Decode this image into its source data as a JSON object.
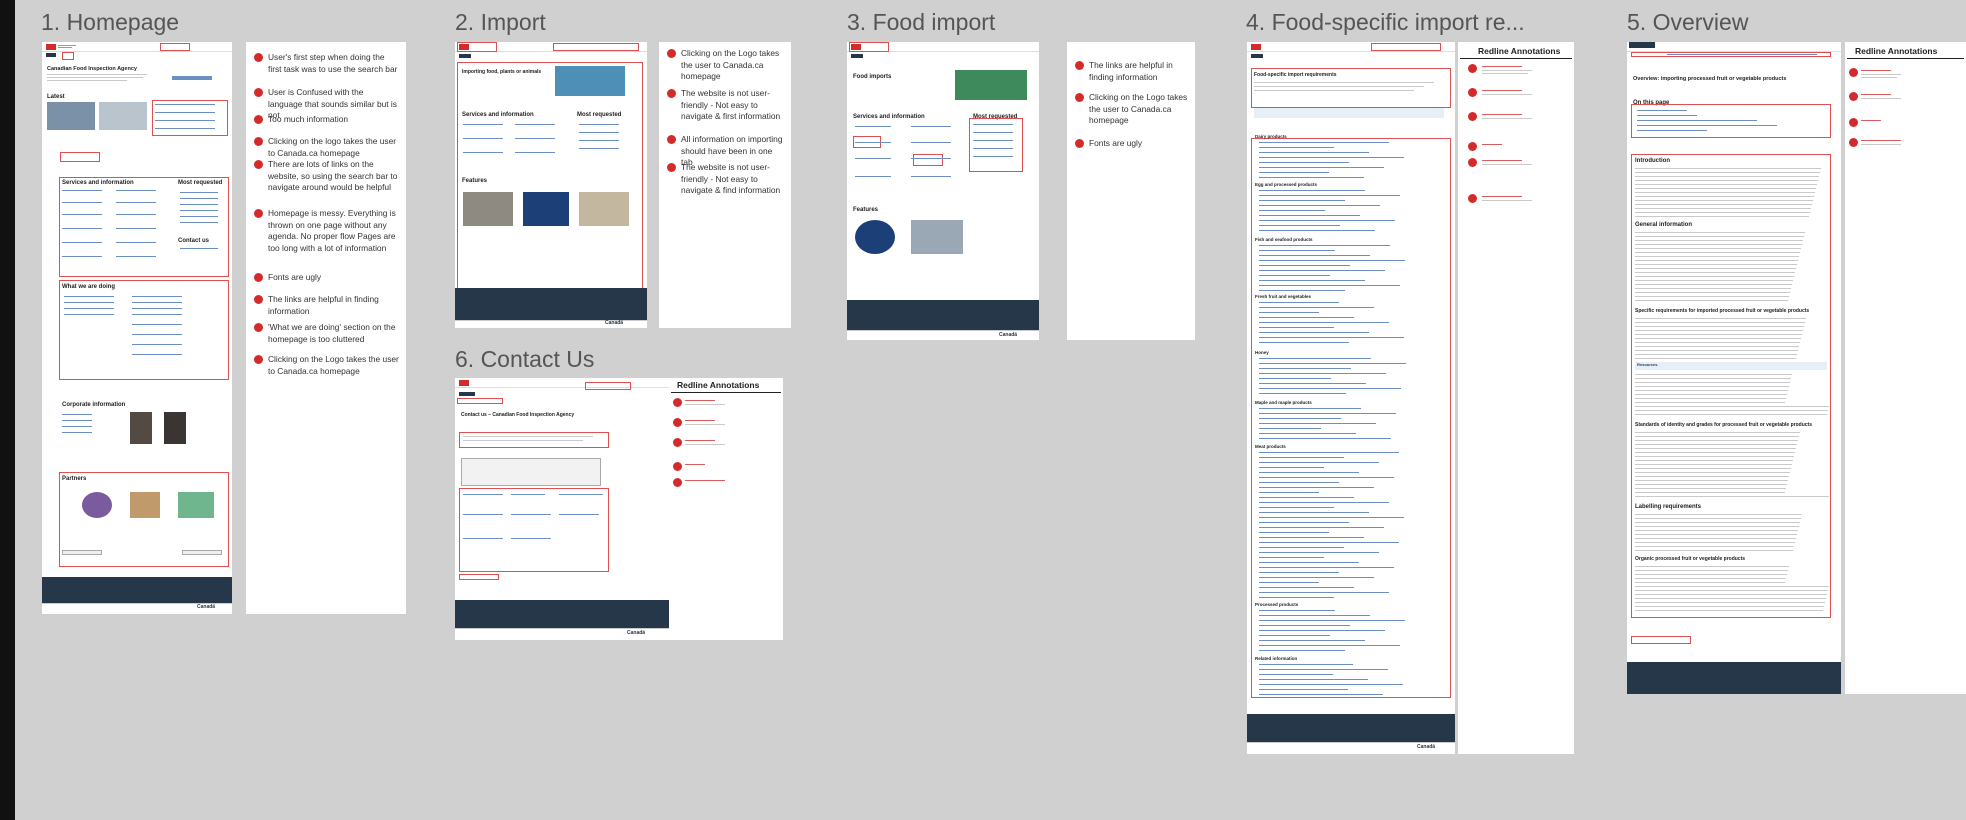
{
  "frames": [
    {
      "title": "1. Homepage"
    },
    {
      "title": "2. Import"
    },
    {
      "title": "3. Food import"
    },
    {
      "title": "4. Food-specific import re..."
    },
    {
      "title": "5. Overview"
    },
    {
      "title": "6. Contact Us"
    }
  ],
  "homepage": {
    "agency_title": "Canadian Food Inspection Agency",
    "latest": "Latest",
    "services": "Services and information",
    "most_requested": "Most requested",
    "contact": "Contact us",
    "what_we_are_doing": "What we are doing",
    "corporate": "Corporate information",
    "partners": "Partners",
    "notes": [
      "User's first step when doing the first task was to use the search bar",
      "User is Confused with the language that sounds similar but is not",
      "Too much information",
      "Clicking on the logo takes the user to Canada.ca homepage",
      "There are lots of links on the website, so using the search bar to navigate around would be helpful",
      "Homepage is messy. Everything is thrown on one page without any agenda. No proper flow Pages are too long with a lot of information",
      "Fonts are ugly",
      "The links are helpful in finding information",
      "'What we are doing' section on the homepage is too cluttered",
      "Clicking on the Logo takes the user to Canada.ca homepage"
    ]
  },
  "import": {
    "heading": "Importing food, plants or animals",
    "services": "Services and information",
    "most_requested": "Most requested",
    "features": "Features",
    "notes": [
      "Clicking on the Logo takes the user to Canada.ca homepage",
      "The website is not user-friendly - Not easy to navigate & first information",
      "All information on importing should have been in one tab",
      "The website is not user-friendly - Not easy to navigate & find information"
    ]
  },
  "food_import": {
    "heading": "Food imports",
    "services": "Services and information",
    "most_requested": "Most requested",
    "features": "Features",
    "notes": [
      "The links are helpful in finding information",
      "Clicking on the Logo takes the user to Canada.ca homepage",
      "Fonts are ugly"
    ]
  },
  "food_specific": {
    "heading": "Food-specific import requirements",
    "redline": "Redline Annotations",
    "sections": [
      "Dairy products",
      "Egg and processed products",
      "Fish and seafood products",
      "Fresh fruit and vegetables",
      "Honey",
      "Maple and maple products",
      "Meat products",
      "Processed products",
      "Related information"
    ]
  },
  "overview": {
    "heading": "Overview: importing processed fruit or vegetable products",
    "redline": "Redline Annotations",
    "on_this_page": "On this page",
    "sections": [
      "Introduction",
      "General information",
      "Specific requirements for imported processed fruit or vegetable products",
      "Standards of identity and grades for processed fruit or vegetable products",
      "Labelling requirements",
      "Organic processed fruit or vegetable products"
    ],
    "resources": "Resources"
  },
  "contact": {
    "heading": "Contact us – Canadian Food Inspection Agency",
    "redline": "Redline Annotations"
  },
  "common": {
    "canada_wordmark": "Canadä",
    "gov_name": "Government of Canada"
  },
  "colors": {
    "marker": "#d32b2b",
    "navbar": "#26374a",
    "canvas": "#d0d0d0",
    "link": "#284162"
  }
}
